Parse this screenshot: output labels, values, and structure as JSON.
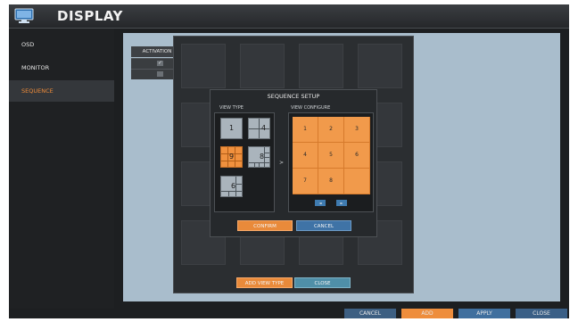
{
  "window": {
    "title": "DISPLAY",
    "icon": "monitor-icon"
  },
  "sidebar": {
    "items": [
      {
        "label": "OSD",
        "active": false
      },
      {
        "label": "MONITOR",
        "active": false
      },
      {
        "label": "SEQUENCE",
        "active": true
      }
    ]
  },
  "table": {
    "header": "ACTIVATION"
  },
  "sequence_setup": {
    "title": "SEQUENCE SETUP",
    "view_type_label": "VIEW TYPE",
    "view_configure_label": "VIEW CONFIGURE",
    "view_types": [
      {
        "label": "1",
        "selected": false
      },
      {
        "label": "4",
        "selected": false
      },
      {
        "label": "9",
        "selected": true
      },
      {
        "label": "8",
        "selected": false
      },
      {
        "label": "6",
        "selected": false
      }
    ],
    "arrow": ">",
    "channels": [
      "1",
      "2",
      "3",
      "4",
      "5",
      "6",
      "7",
      "8",
      ""
    ],
    "prev_label": "◄",
    "next_label": "►",
    "confirm_label": "CONFIRM",
    "cancel_label": "CANCEL"
  },
  "add_view_dialog": {
    "add_label": "ADD VIEW TYPE",
    "close_label": "CLOSE"
  },
  "footer": {
    "cancel": "CANCEL",
    "add": "ADD",
    "apply": "APPLY",
    "close": "CLOSE"
  },
  "colors": {
    "accent": "#f0913e",
    "button_blue": "#3f73a6",
    "panel": "#a9bdcc"
  }
}
